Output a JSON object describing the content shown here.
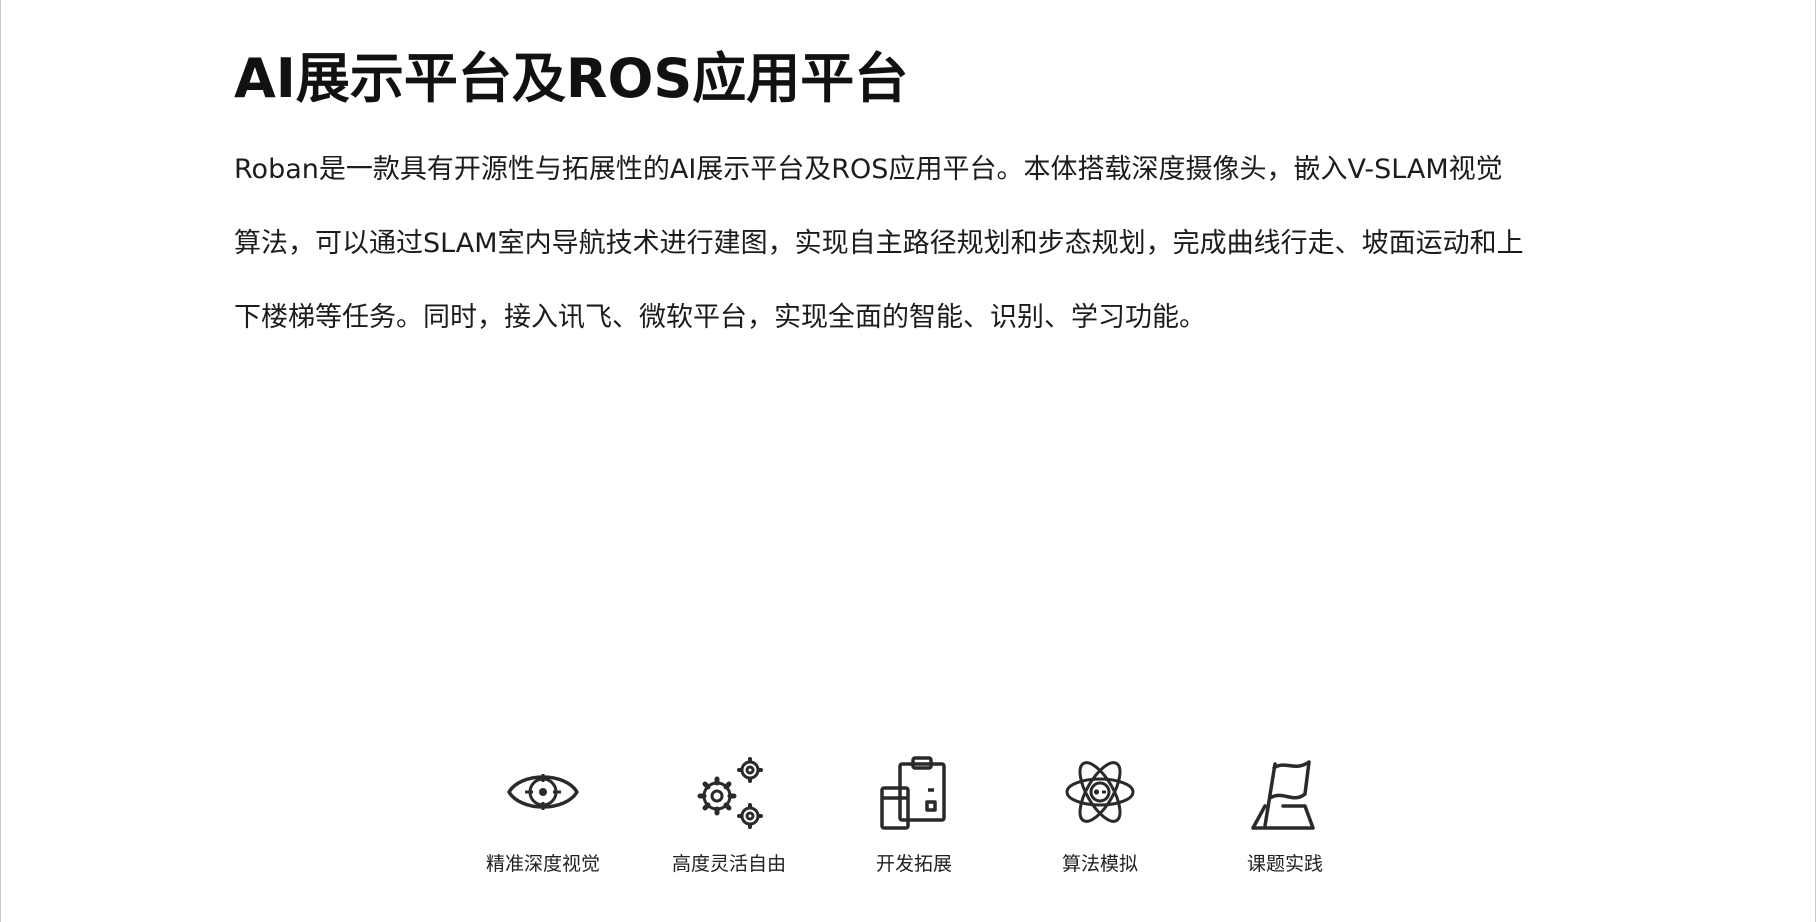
{
  "header": {
    "title": "AI展示平台及ROS应用平台"
  },
  "intro": {
    "lines": [
      "Roban是一款具有开源性与拓展性的AI展示平台及ROS应用平台。本体搭载深度摄像头，嵌入V-SLAM视觉",
      "算法，可以通过SLAM室内导航技术进行建图，实现自主路径规划和步态规划，完成曲线行走、坡面运动和上",
      "下楼梯等任务。同时，接入讯飞、微软平台，实现全面的智能、识别、学习功能。"
    ]
  },
  "features": [
    {
      "icon": "eye-target-icon",
      "label": "精准深度视觉"
    },
    {
      "icon": "gears-icon",
      "label": "高度灵活自由"
    },
    {
      "icon": "clipboard-devices-icon",
      "label": "开发拓展"
    },
    {
      "icon": "atom-icon",
      "label": "算法模拟"
    },
    {
      "icon": "flag-icon",
      "label": "课题实践"
    }
  ],
  "colors": {
    "text": "#1a1a1a",
    "icon_stroke": "#2a2a2a",
    "background": "#ffffff"
  }
}
